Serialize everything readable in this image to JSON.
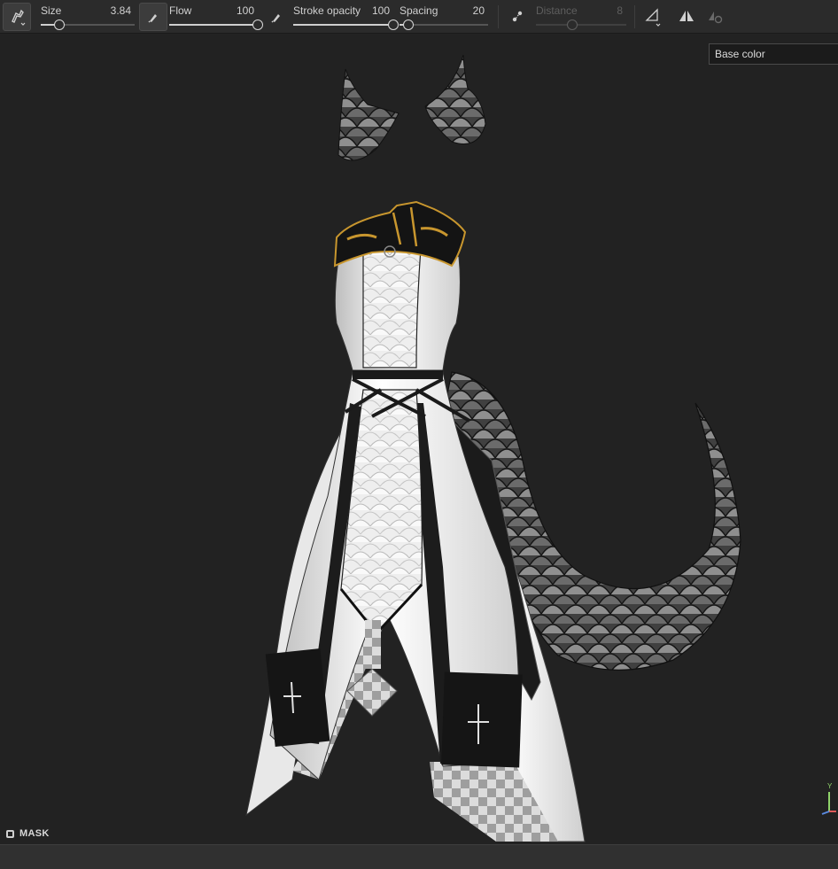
{
  "toolbar": {
    "size": {
      "label": "Size",
      "value": "3.84",
      "fraction": 0.2
    },
    "flow": {
      "label": "Flow",
      "value": "100",
      "fraction": 1.0
    },
    "stroke_opacity": {
      "label": "Stroke opacity",
      "value": "100",
      "fraction": 1.0
    },
    "spacing": {
      "label": "Spacing",
      "value": "20",
      "fraction": 0.1
    },
    "distance": {
      "label": "Distance",
      "value": "8",
      "fraction": 0.4,
      "disabled": true
    }
  },
  "channel": {
    "selected": "Base color"
  },
  "mask": {
    "label": "MASK"
  },
  "gizmo": {
    "y_label": "Y"
  },
  "icons": {
    "tool": "brush-tool-icon",
    "flow_pressure": "pen-pressure-icon",
    "stroke_pressure": "pen-pressure-icon",
    "lazy_mouse": "lazy-mouse-icon",
    "alignment": "alignment-icon",
    "symmetry": "symmetry-icon",
    "symmetry_settings": "symmetry-settings-icon"
  },
  "colors": {
    "background": "#222222",
    "toolbar": "#2b2b2b",
    "accent_gold": "#c8962e"
  }
}
